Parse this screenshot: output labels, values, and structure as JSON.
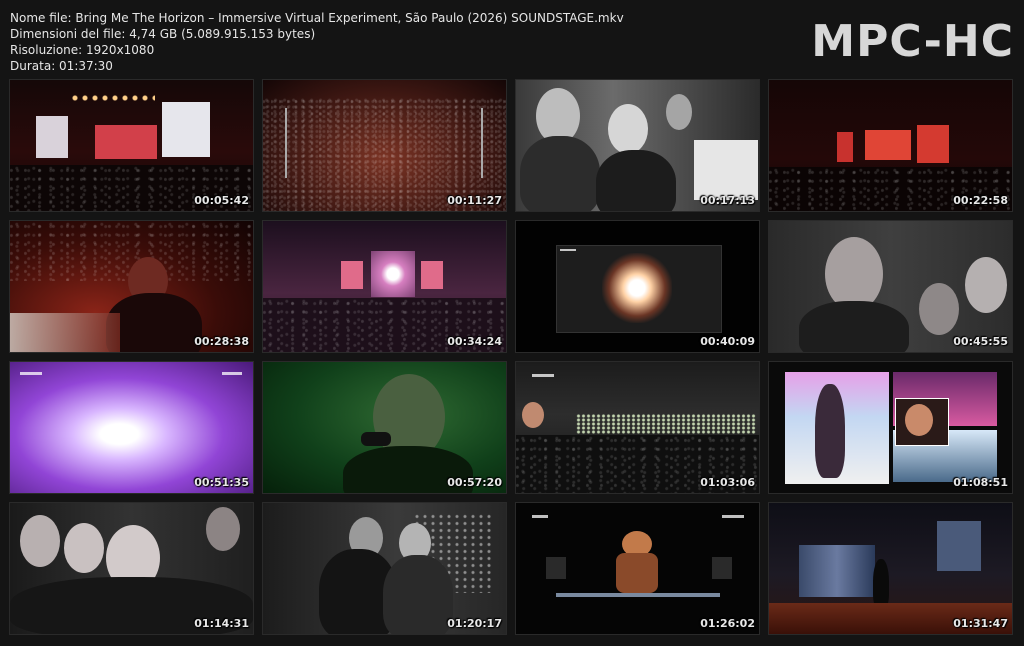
{
  "file_info": {
    "name_line": "Nome file: Bring Me The Horizon – Immersive Virtual Experiment, São Paulo (2026) SOUNDSTAGE.mkv",
    "size_line": "Dimensioni del file: 4,74 GB (5.089.915.153 bytes)",
    "resolution_line": "Risoluzione: 1920x1080",
    "duration_line": "Durata: 01:37:30"
  },
  "logo": {
    "text": "MPC-HC"
  },
  "thumbnails": [
    {
      "time": "00:05:42"
    },
    {
      "time": "00:11:27"
    },
    {
      "time": "00:17:13"
    },
    {
      "time": "00:22:58"
    },
    {
      "time": "00:28:38"
    },
    {
      "time": "00:34:24"
    },
    {
      "time": "00:40:09"
    },
    {
      "time": "00:45:55"
    },
    {
      "time": "00:51:35"
    },
    {
      "time": "00:57:20"
    },
    {
      "time": "01:03:06"
    },
    {
      "time": "01:08:51"
    },
    {
      "time": "01:14:31"
    },
    {
      "time": "01:20:17"
    },
    {
      "time": "01:26:02"
    },
    {
      "time": "01:31:47"
    }
  ]
}
